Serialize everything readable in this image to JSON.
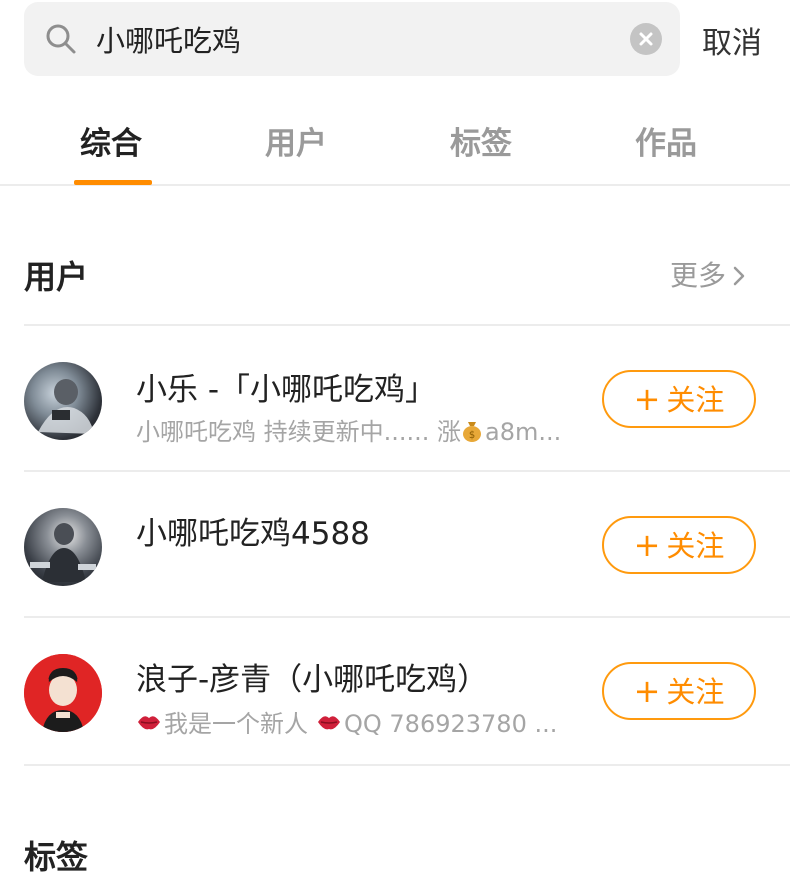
{
  "search": {
    "query": "小哪吒吃鸡",
    "cancel_label": "取消"
  },
  "tabs": [
    {
      "label": "综合",
      "active": true
    },
    {
      "label": "用户",
      "active": false
    },
    {
      "label": "标签",
      "active": false
    },
    {
      "label": "作品",
      "active": false
    }
  ],
  "users_section": {
    "title": "用户",
    "more_label": "更多"
  },
  "users": [
    {
      "name": "小乐 -「小哪吒吃鸡」",
      "desc_before": "小哪吒吃鸡 持续更新中...... 涨",
      "desc_after": "a8m...",
      "follow_label": "关注"
    },
    {
      "name": "小哪吒吃鸡4588",
      "follow_label": "关注"
    },
    {
      "name": "浪子-彦青（小哪吒吃鸡）",
      "desc_part1": "我是一个新人",
      "desc_part2": "QQ 786923780 ...",
      "follow_label": "关注"
    }
  ],
  "tags_section": {
    "title": "标签"
  },
  "colors": {
    "accent": "#ff8c00",
    "text_primary": "#222222",
    "text_secondary": "#a5a5a5",
    "divider": "#ececec"
  }
}
